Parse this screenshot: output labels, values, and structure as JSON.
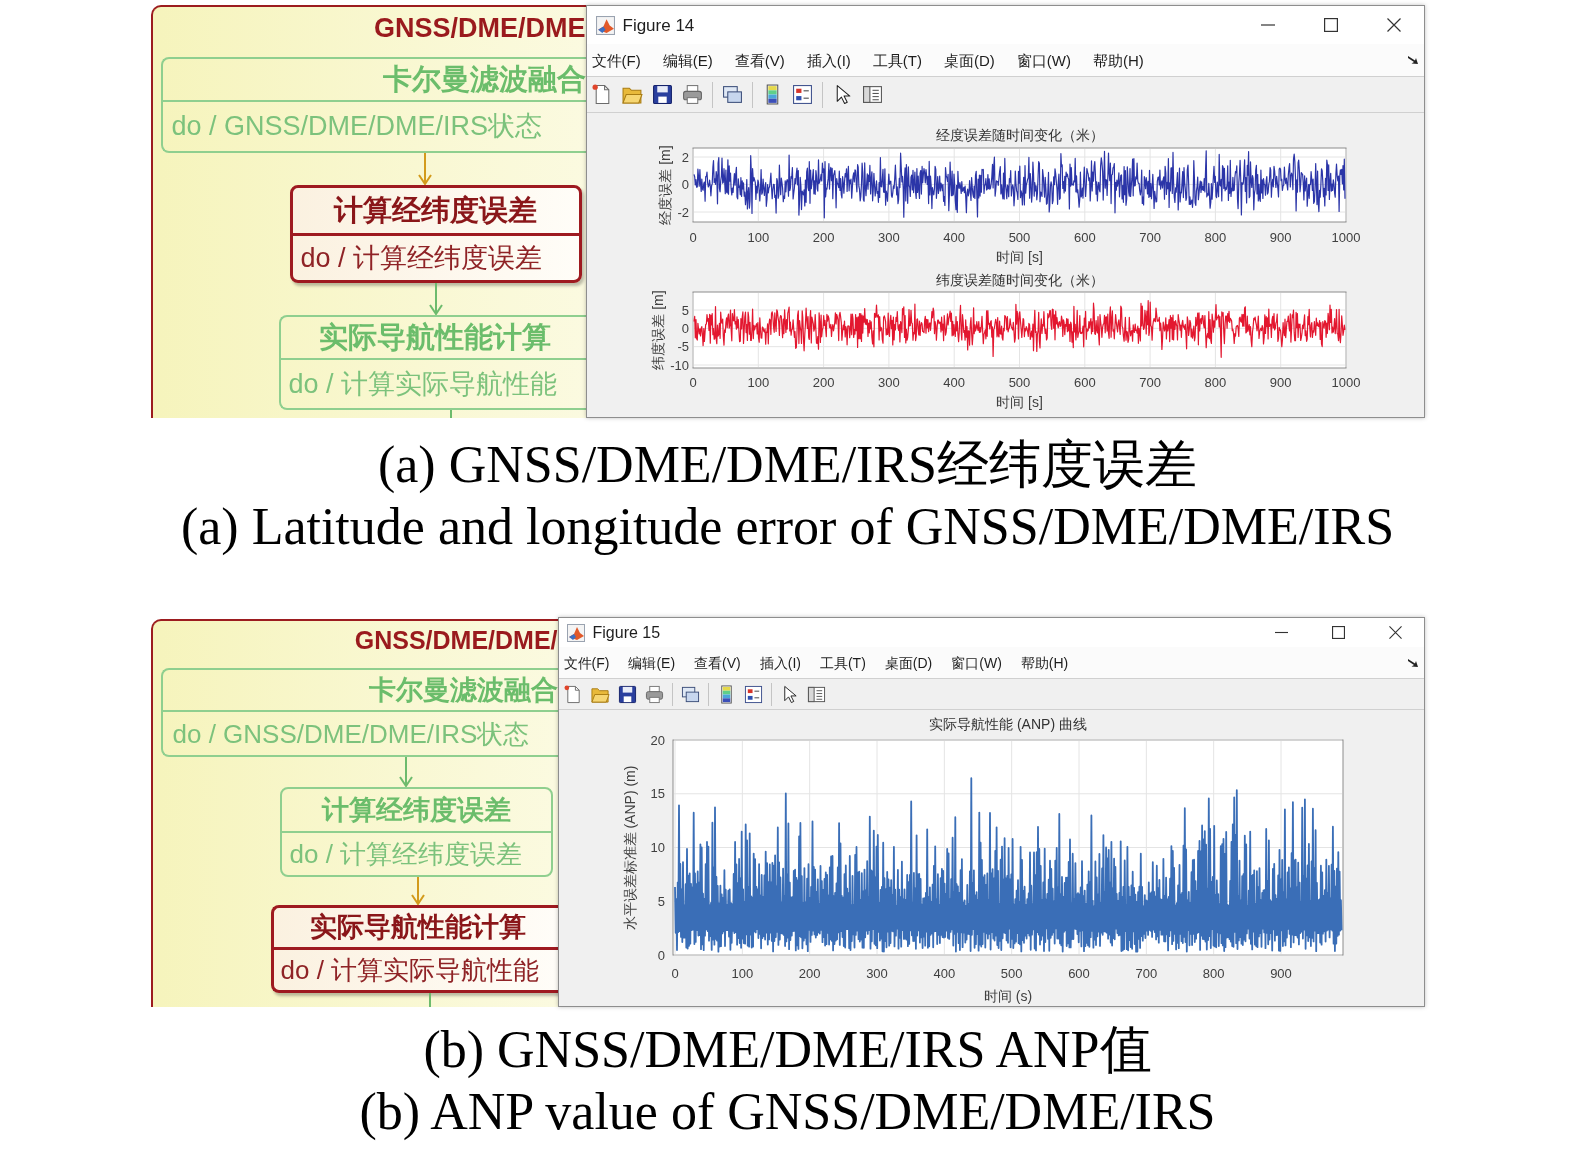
{
  "panels": [
    {
      "diagram": {
        "title": "GNSS/DME/DME",
        "states": [
          {
            "name": "卡尔曼滤波融合",
            "action": "do / GNSS/DME/DME/IRS状态",
            "active": false
          },
          {
            "name": "计算经纬度误差",
            "action": "do / 计算经纬度误差",
            "active": true
          },
          {
            "name": "实际导航性能计算",
            "action": "do / 计算实际导航性能",
            "active": false
          }
        ]
      },
      "figure_window": {
        "title": "Figure 14",
        "menu": [
          "文件(F)",
          "编辑(E)",
          "查看(V)",
          "插入(I)",
          "工具(T)",
          "桌面(D)",
          "窗口(W)",
          "帮助(H)"
        ],
        "plots": [
          {
            "kind": "error",
            "title": "经度误差随时间变化（米）",
            "ylabel": "经度误差 [m]",
            "yticks": [
              "2",
              "0",
              "-2"
            ],
            "xticks": [
              "0",
              "100",
              "200",
              "300",
              "400",
              "500",
              "600",
              "700",
              "800",
              "900",
              "1000"
            ],
            "xlabel": "时间 [s]",
            "color": "#2b35a8"
          },
          {
            "kind": "error",
            "title": "纬度误差随时间变化（米）",
            "ylabel": "纬度误差 [m]",
            "yticks": [
              "5",
              "0",
              "-5",
              "-10"
            ],
            "xticks": [
              "0",
              "100",
              "200",
              "300",
              "400",
              "500",
              "600",
              "700",
              "800",
              "900",
              "1000"
            ],
            "xlabel": "时间 [s]",
            "color": "#e3172f"
          }
        ]
      },
      "captions": [
        "(a) GNSS/DME/DME/IRS经纬度误差",
        "(a) Latitude and longitude error of GNSS/DME/DME/IRS"
      ]
    },
    {
      "diagram": {
        "title": "GNSS/DME/DME/",
        "states": [
          {
            "name": "卡尔曼滤波融合",
            "action": "do / GNSS/DME/DME/IRS状态",
            "active": false
          },
          {
            "name": "计算经纬度误差",
            "action": "do / 计算经纬度误差",
            "active": false
          },
          {
            "name": "实际导航性能计算",
            "action": "do / 计算实际导航性能",
            "active": true
          }
        ]
      },
      "figure_window": {
        "title": "Figure 15",
        "menu": [
          "文件(F)",
          "编辑(E)",
          "查看(V)",
          "插入(I)",
          "工具(T)",
          "桌面(D)",
          "窗口(W)",
          "帮助(H)"
        ],
        "plots": [
          {
            "kind": "magnitude",
            "title": "实际导航性能 (ANP) 曲线",
            "ylabel": "水平误差标准差 (ANP) (m)",
            "yticks": [
              "20",
              "15",
              "10",
              "5",
              "0"
            ],
            "xticks": [
              "0",
              "100",
              "200",
              "300",
              "400",
              "500",
              "600",
              "700",
              "800",
              "900"
            ],
            "xlabel": "时间 (s)",
            "color": "#3a6eb7"
          }
        ]
      },
      "captions": [
        "(b) GNSS/DME/DME/IRS ANP值",
        "(b) ANP value of GNSS/DME/DME/IRS"
      ]
    }
  ]
}
